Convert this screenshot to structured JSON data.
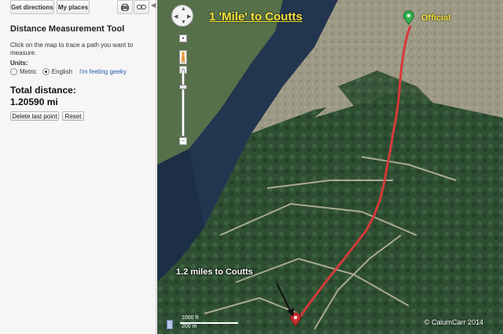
{
  "toolbar": {
    "directions_label": "Get directions",
    "places_label": "My places",
    "print_icon": "print-icon",
    "link_icon": "link-icon",
    "collapse_icon": "chevron-left-icon"
  },
  "tool": {
    "title": "Distance Measurement Tool",
    "description": "Click on the map to trace a path you want to measure.",
    "units_label": "Units:",
    "unit_metric": "Metric",
    "unit_english": "English",
    "selected_unit": "English",
    "geeky_link": "I'm feeling geeky",
    "total_label": "Total distance:",
    "total_value": "1.20590 mi",
    "delete_button": "Delete last point",
    "reset_button": "Reset"
  },
  "map": {
    "title": "1 'Mile' to Coutts",
    "official_label": "Official",
    "annotation": "1.2 miles to Coutts",
    "copyright": "© CalumCarr 2014",
    "scale_ft": "1000 ft",
    "scale_m": "200 m",
    "colors": {
      "label_yellow": "#f7e33a",
      "path_red": "#d63a3a",
      "start_marker": "#2fb34a",
      "end_marker": "#c9302c"
    }
  }
}
